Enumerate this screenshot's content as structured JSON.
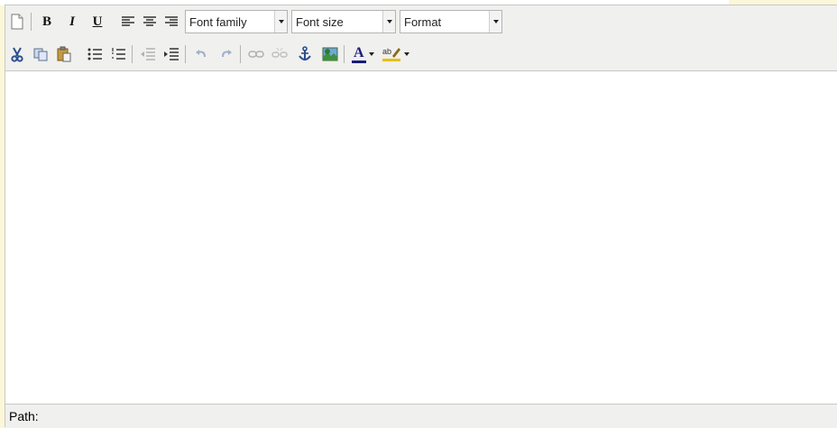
{
  "toolbar": {
    "font_family": {
      "label": "Font family"
    },
    "font_size": {
      "label": "Font size"
    },
    "format": {
      "label": "Format"
    }
  },
  "status_bar": {
    "path_label": "Path:"
  },
  "icons": {
    "new_document": "new-document-icon",
    "bold": "B",
    "italic": "I",
    "underline": "U",
    "align_left": "align-left-icon",
    "align_center": "align-center-icon",
    "align_right": "align-right-icon",
    "cut": "scissors-icon",
    "copy": "copy-icon",
    "paste": "paste-icon",
    "bullet_list": "bullet-list-icon",
    "numbered_list": "numbered-list-icon",
    "outdent": "outdent-icon",
    "indent": "indent-icon",
    "undo": "undo-icon",
    "redo": "redo-icon",
    "link": "link-icon",
    "unlink": "unlink-icon",
    "anchor": "anchor-icon",
    "image": "image-icon",
    "text_color": "A",
    "highlight": "highlight-icon"
  },
  "colors": {
    "accent": "#1a1a7a",
    "toolbar_bg": "#f0f0ee",
    "page_bg": "#fbf7d8",
    "highlight": "#e8c000"
  }
}
